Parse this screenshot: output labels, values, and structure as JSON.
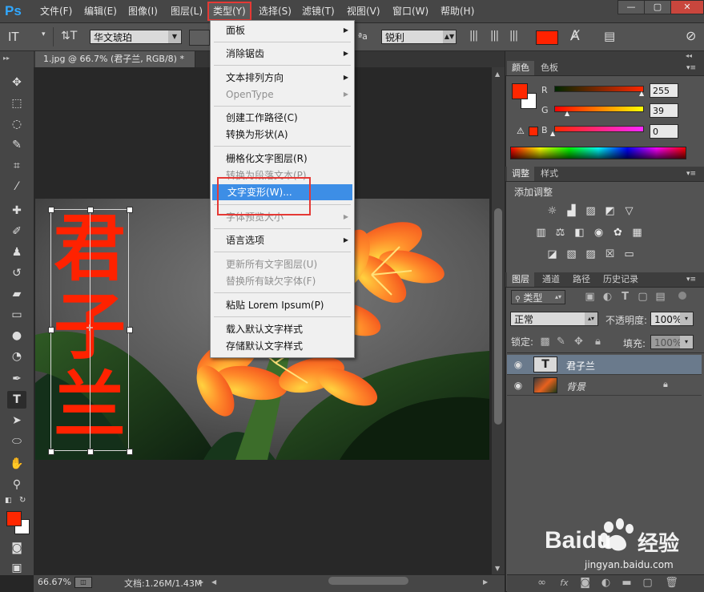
{
  "app": {
    "logo": "Ps"
  },
  "menubar": {
    "items": [
      "文件(F)",
      "编辑(E)",
      "图像(I)",
      "图层(L)",
      "类型(Y)",
      "选择(S)",
      "滤镜(T)",
      "视图(V)",
      "窗口(W)",
      "帮助(H)"
    ],
    "active": "类型(Y)",
    "window_buttons": [
      "—",
      "▢",
      "✕"
    ]
  },
  "options": {
    "tool_glyph": "IT",
    "orient_glyph": "⇅T",
    "font_family": "华文琥珀",
    "aa_label": "ªa",
    "antialias": "锐利",
    "text_color": "#ff2200"
  },
  "document": {
    "tab_title": "1.jpg @ 66.7% (君子兰, RGB/8) *",
    "close": "×",
    "text_content": [
      "君",
      "子",
      "兰"
    ],
    "text_color": "#ff2200"
  },
  "type_menu": {
    "items": [
      {
        "label": "面板",
        "sub": true,
        "disabled": false
      },
      {
        "label": "消除锯齿",
        "sub": true,
        "disabled": false
      },
      {
        "label": "文本排列方向",
        "sub": true,
        "disabled": false
      },
      {
        "label": "OpenType",
        "sub": true,
        "disabled": true
      },
      {
        "label": "创建工作路径(C)",
        "sub": false,
        "disabled": false
      },
      {
        "label": "转换为形状(A)",
        "sub": false,
        "disabled": false
      },
      {
        "label": "栅格化文字图层(R)",
        "sub": false,
        "disabled": false
      },
      {
        "label": "转换为段落文本(P)",
        "sub": false,
        "disabled": true
      },
      {
        "label": "文字变形(W)...",
        "sub": false,
        "disabled": false,
        "highlighted": true
      },
      {
        "label": "字体预览大小",
        "sub": true,
        "disabled": true
      },
      {
        "label": "语言选项",
        "sub": true,
        "disabled": false
      },
      {
        "label": "更新所有文字图层(U)",
        "sub": false,
        "disabled": true
      },
      {
        "label": "替换所有缺欠字体(F)",
        "sub": false,
        "disabled": true
      },
      {
        "label": "粘贴 Lorem Ipsum(P)",
        "sub": false,
        "disabled": false
      },
      {
        "label": "载入默认文字样式",
        "sub": false,
        "disabled": false
      },
      {
        "label": "存储默认文字样式",
        "sub": false,
        "disabled": false
      }
    ]
  },
  "status": {
    "zoom": "66.67%",
    "doc_label": "文档:1.26M/1.43M"
  },
  "color_panel": {
    "tabs": [
      "颜色",
      "色板"
    ],
    "r_label": "R",
    "g_label": "G",
    "b_label": "B",
    "r": "255",
    "g": "39",
    "b": "0",
    "foreground": "#ff2700",
    "background": "#ffffff"
  },
  "adjust_panel": {
    "tabs": [
      "调整",
      "样式"
    ],
    "title": "添加调整"
  },
  "layers_panel": {
    "tabs": [
      "图层",
      "通道",
      "路径",
      "历史记录"
    ],
    "filter_label": "类型",
    "blend_mode": "正常",
    "opacity_label": "不透明度:",
    "opacity": "100%",
    "lock_label": "锁定:",
    "fill_label": "填充:",
    "fill": "100%",
    "layers": [
      {
        "name": "君子兰",
        "type": "text",
        "selected": true
      },
      {
        "name": "背景",
        "type": "image",
        "selected": false,
        "locked": true
      }
    ]
  },
  "watermark": {
    "brand": "Baidu",
    "cn": "经验",
    "url": "jingyan.baidu.com"
  }
}
